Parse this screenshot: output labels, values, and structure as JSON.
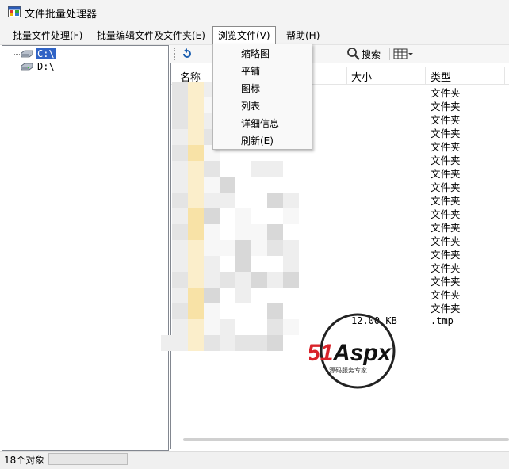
{
  "window": {
    "title": "文件批量处理器"
  },
  "menu": {
    "items": [
      {
        "label": "批量文件处理(F)"
      },
      {
        "label": "批量编辑文件及文件夹(E)"
      },
      {
        "label": "浏览文件(V)"
      },
      {
        "label": "帮助(H)"
      }
    ]
  },
  "view_menu": {
    "items": [
      {
        "label": "缩略图"
      },
      {
        "label": "平铺"
      },
      {
        "label": "图标"
      },
      {
        "label": "列表"
      },
      {
        "label": "详细信息"
      },
      {
        "label": "刷新(E)"
      }
    ]
  },
  "tree": {
    "drives": [
      {
        "label": "C:\\",
        "selected": true
      },
      {
        "label": "D:\\",
        "selected": false
      }
    ]
  },
  "toolbar": {
    "search_label": "搜索",
    "icons": [
      "undo-icon",
      "search-icon",
      "view-grid-icon"
    ]
  },
  "list": {
    "columns": {
      "name": "名称",
      "size": "大小",
      "type": "类型"
    },
    "folder_type_label": "文件夹",
    "folder_count": 17,
    "file_row": {
      "size": "12.00 KB",
      "type": ".tmp"
    }
  },
  "watermark": {
    "brand_51": "51",
    "brand_aspx": "Aspx",
    "tagline": "源码服务专家"
  },
  "status": {
    "object_count_text": "18个对象"
  }
}
